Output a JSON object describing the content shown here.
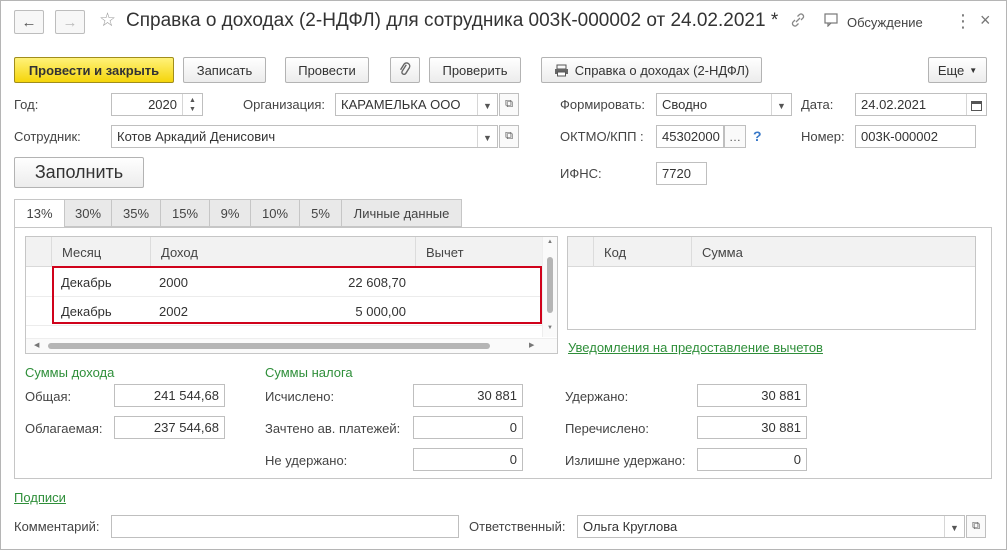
{
  "window": {
    "title": "Справка о доходах (2-НДФЛ) для сотрудника 003К-000002 от 24.02.2021 *",
    "discussion": "Обсуждение"
  },
  "toolbar": {
    "post_close": "Провести и закрыть",
    "save": "Записать",
    "post": "Провести",
    "check": "Проверить",
    "print": "Справка о доходах (2-НДФЛ)",
    "more": "Еще"
  },
  "header": {
    "year_label": "Год:",
    "year": "2020",
    "org_label": "Организация:",
    "org": "КАРАМЕЛЬКА ООО",
    "form_label": "Формировать:",
    "form": "Сводно",
    "date_label": "Дата:",
    "date": "24.02.2021",
    "emp_label": "Сотрудник:",
    "employee": "Котов Аркадий Денисович",
    "oktmo_label": "ОКТМО/КПП :",
    "oktmo": "45302000",
    "number_label": "Номер:",
    "number": "003К-000002",
    "ifns_label": "ИФНС:",
    "ifns": "7720",
    "fill_button": "Заполнить"
  },
  "tabs": [
    "13%",
    "30%",
    "35%",
    "15%",
    "9%",
    "10%",
    "5%",
    "Личные данные"
  ],
  "income_table": {
    "columns": [
      "Месяц",
      "Доход",
      "Вычет"
    ],
    "rows": [
      {
        "month": "Декабрь",
        "code": "2000",
        "amount": "22 608,70",
        "deduction": ""
      },
      {
        "month": "Декабрь",
        "code": "2002",
        "amount": "5 000,00",
        "deduction": ""
      }
    ]
  },
  "deduction_table": {
    "columns": [
      "Код",
      "Сумма"
    ]
  },
  "notifications_link": "Уведомления на предоставление вычетов",
  "income_sums": {
    "title": "Суммы дохода",
    "total_label": "Общая:",
    "total": "241 544,68",
    "taxable_label": "Облагаемая:",
    "taxable": "237 544,68"
  },
  "tax_sums": {
    "title": "Суммы налога",
    "calculated_label": "Исчислено:",
    "calculated": "30 881",
    "offset_label": "Зачтено ав. платежей:",
    "offset": "0",
    "not_withheld_label": "Не удержано:",
    "not_withheld": "0",
    "withheld_label": "Удержано:",
    "withheld": "30 881",
    "transferred_label": "Перечислено:",
    "transferred": "30 881",
    "over_withheld_label": "Излишне удержано:",
    "over_withheld": "0"
  },
  "footer": {
    "signatures_link": "Подписи",
    "comment_label": "Комментарий:",
    "comment": "",
    "responsible_label": "Ответственный:",
    "responsible": "Ольга Круглова"
  },
  "colors": {
    "accent_green": "#2f8f3a",
    "highlight_red": "#d0021b",
    "primary_yellow": "#f5d50b"
  }
}
